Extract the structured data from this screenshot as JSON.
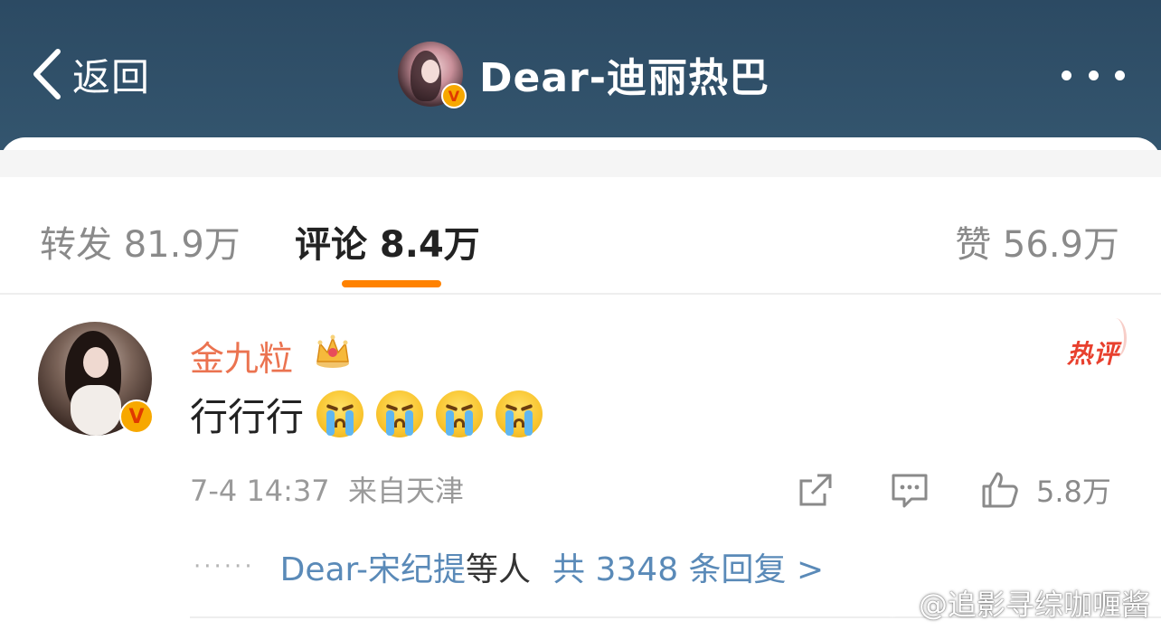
{
  "header": {
    "back_label": "返回",
    "title": "Dear-迪丽热巴",
    "verified_mark": "V"
  },
  "tabs": {
    "repost": "转发 81.9万",
    "comment": "评论 8.4万",
    "like": "赞 56.9万",
    "active": "comment",
    "accent_color": "#ff8200"
  },
  "comment": {
    "user_name": "金九粒",
    "verified_mark": "V",
    "hot_badge": "热评",
    "text": "行行行",
    "emojis": [
      "crying-face-icon",
      "crying-face-icon",
      "crying-face-icon",
      "crying-face-icon"
    ],
    "meta": "7-4 14:37  来自天津",
    "like_count": "5.8万",
    "replies": {
      "dots": "······",
      "user": "Dear-宋纪提",
      "others": "等人",
      "total": "共 3348 条回复 >"
    },
    "name_color": "#eb7350",
    "link_color": "#5a8ab8"
  },
  "watermark": {
    "text": "@追影寻综咖喱酱"
  }
}
